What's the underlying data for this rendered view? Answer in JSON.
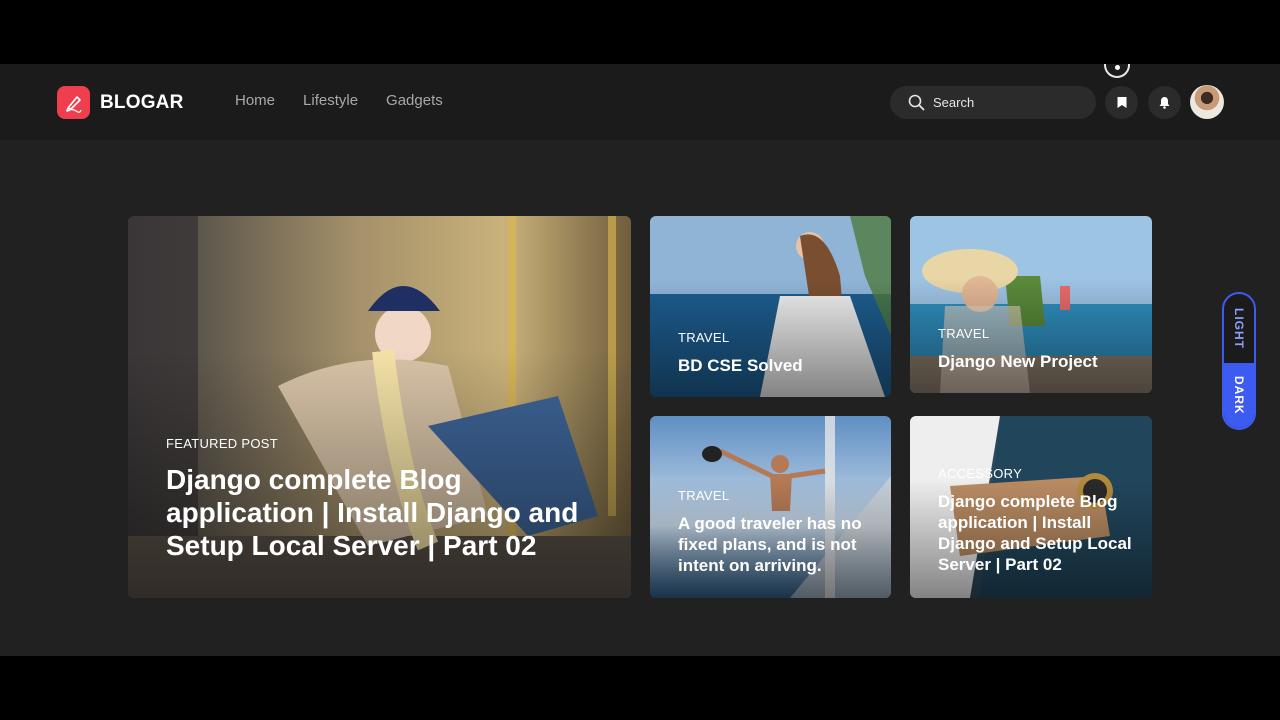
{
  "brand": {
    "name": "BLOGAR",
    "accent": "#ef3f4e"
  },
  "nav": {
    "items": [
      {
        "label": "Home"
      },
      {
        "label": "Lifestyle"
      },
      {
        "label": "Gadgets"
      }
    ]
  },
  "search": {
    "placeholder": "Search"
  },
  "header_icons": {
    "bookmark": "bookmark-icon",
    "notifications": "bell-icon",
    "avatar": "user-avatar"
  },
  "featured": {
    "tag": "FEATURED POST",
    "title": "Django complete Blog application | Install Django and Setup Local Server | Part 02"
  },
  "posts": [
    {
      "tag": "TRAVEL",
      "title": "BD CSE Solved"
    },
    {
      "tag": "TRAVEL",
      "title": "Django New Project"
    },
    {
      "tag": "TRAVEL",
      "title": "A good traveler has no fixed plans, and is not intent on arriving."
    },
    {
      "tag": "ACCESSORY",
      "title": "Django complete Blog application | Install Django and Setup Local Server | Part 02"
    }
  ],
  "theme_toggle": {
    "light": "LIGHT",
    "dark": "DARK",
    "active": "DARK",
    "active_color": "#3d5bf0"
  },
  "colors": {
    "page_bg": "#212121",
    "header_bg": "#1b1b1b",
    "nav_link": "#a8a8a8"
  }
}
